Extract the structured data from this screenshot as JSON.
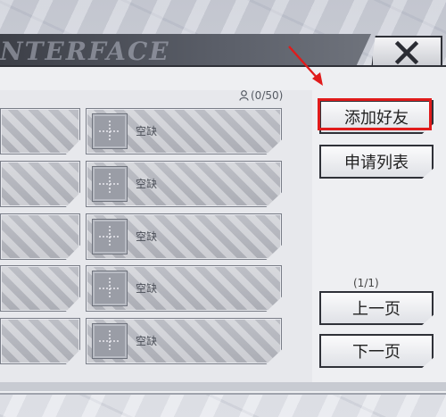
{
  "header": {
    "title_partial": "NTERFACE"
  },
  "close": {
    "icon": "close-icon"
  },
  "friends": {
    "count": "(0/50)"
  },
  "slots": [
    {
      "label": "空缺"
    },
    {
      "label": "空缺"
    },
    {
      "label": "空缺"
    },
    {
      "label": "空缺"
    },
    {
      "label": "空缺"
    }
  ],
  "sidebar": {
    "add_friend": "添加好友",
    "request_list": "申请列表",
    "page_indicator": "(1/1)",
    "prev_page": "上一页",
    "next_page": "下一页"
  },
  "annotation": {
    "color": "#e01b1b"
  }
}
